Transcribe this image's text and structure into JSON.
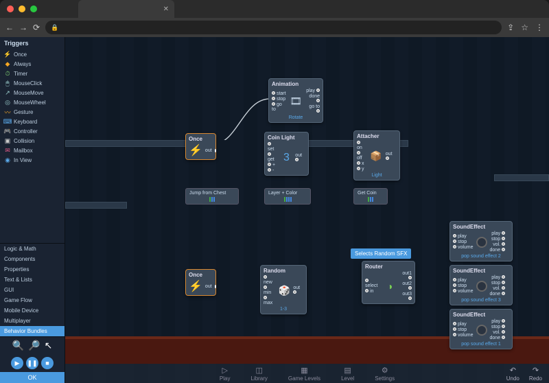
{
  "browser": {
    "tab_close": "✕"
  },
  "sidebar": {
    "section_title": "Triggers",
    "items": [
      {
        "icon": "⚡",
        "label": "Once",
        "color": "#f5a623"
      },
      {
        "icon": "◆",
        "label": "Always",
        "color": "#f5a623"
      },
      {
        "icon": "⏱",
        "label": "Timer",
        "color": "#7bc96f"
      },
      {
        "icon": "🖱",
        "label": "MouseClick",
        "color": "#9cc"
      },
      {
        "icon": "↗",
        "label": "MouseMove",
        "color": "#9cc"
      },
      {
        "icon": "◎",
        "label": "MouseWheel",
        "color": "#9cc"
      },
      {
        "icon": "〰",
        "label": "Gesture",
        "color": "#f5a623"
      },
      {
        "icon": "⌨",
        "label": "Keyboard",
        "color": "#5aa8e8"
      },
      {
        "icon": "🎮",
        "label": "Controller",
        "color": "#ccc"
      },
      {
        "icon": "▣",
        "label": "Collision",
        "color": "#ccc"
      },
      {
        "icon": "✉",
        "label": "Mailbox",
        "color": "#e85a8a"
      },
      {
        "icon": "◉",
        "label": "In View",
        "color": "#5aa8e8"
      }
    ],
    "categories": [
      "Logic & Math",
      "Components",
      "Properties",
      "Text & Lists",
      "GUI",
      "Game Flow",
      "Mobile Device",
      "Multiplayer",
      "Behavior Bundles"
    ],
    "ok_label": "OK"
  },
  "nodes": {
    "animation": {
      "title": "Animation",
      "in": [
        "start",
        "stop",
        "go to"
      ],
      "out": [
        "play",
        "done",
        "go to"
      ],
      "footer": "Rotate"
    },
    "once1": {
      "title": "Once",
      "out": "out"
    },
    "coinlight": {
      "title": "Coin Light",
      "in": [
        "set",
        "get",
        "+",
        "-"
      ],
      "val": "3",
      "out": "out"
    },
    "attacher": {
      "title": "Attacher",
      "in": [
        "on",
        "off",
        "x",
        "y"
      ],
      "out": "out",
      "footer": "Light"
    },
    "jump": {
      "title": "Jump from Chest"
    },
    "layercolor": {
      "title": "Layer + Color"
    },
    "getcoin": {
      "title": "Get Coin"
    },
    "once2": {
      "title": "Once",
      "out": "out"
    },
    "random": {
      "title": "Random",
      "in": [
        "new",
        "min",
        "max"
      ],
      "out": "out",
      "footer": "1-3"
    },
    "router": {
      "title": "Router",
      "in": [
        "select",
        "in"
      ],
      "out": [
        "out1",
        "out2",
        "out3"
      ]
    },
    "comment": "Selects Random SFX",
    "sfx": {
      "title": "SoundEffect",
      "in": [
        "play",
        "stop",
        "volume"
      ],
      "out": [
        "play",
        "stop",
        "vol.",
        "done"
      ],
      "footers": [
        "pop sound effect 2",
        "pop sound effect 3",
        "pop sound effect 1"
      ]
    }
  },
  "bottombar": {
    "items": [
      "Play",
      "Library",
      "Game Levels",
      "Level",
      "Settings"
    ],
    "right": [
      "Undo",
      "Redo"
    ]
  }
}
